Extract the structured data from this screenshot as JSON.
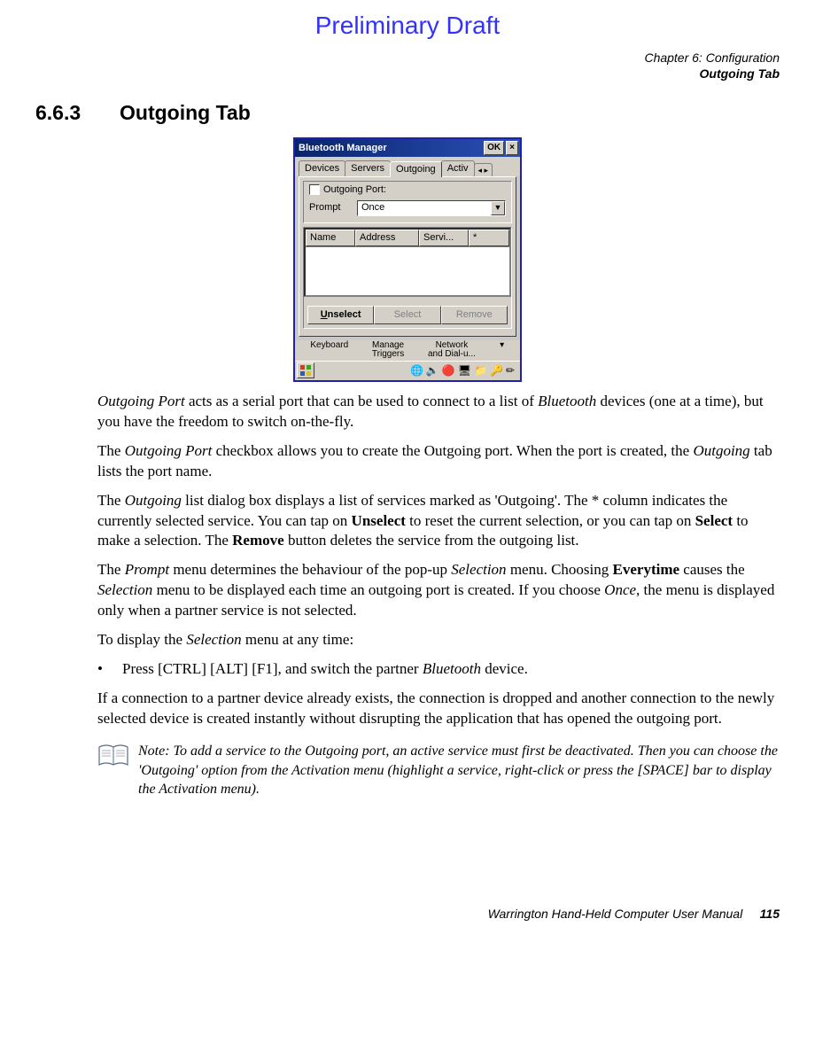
{
  "watermark": "Preliminary Draft",
  "chapter": {
    "line1": "Chapter 6: Configuration",
    "line2": "Outgoing Tab"
  },
  "heading": {
    "number": "6.6.3",
    "title": "Outgoing Tab"
  },
  "screenshot": {
    "window_title": "Bluetooth Manager",
    "ok_button": "OK",
    "close_button": "×",
    "tabs": {
      "devices": "Devices",
      "servers": "Servers",
      "outgoing": "Outgoing",
      "activ": "Activ"
    },
    "tab_scroll": "◂ ▸",
    "group_label": "Outgoing Port:",
    "prompt_label": "Prompt",
    "prompt_value": "Once",
    "list_headers": {
      "name": "Name",
      "address": "Address",
      "service": "Servi...",
      "star": "*"
    },
    "buttons": {
      "unselect_u": "U",
      "unselect_rest": "nselect",
      "select": "Select",
      "remove": "Remove"
    },
    "bg_labels": {
      "keyboard": "Keyboard",
      "manage1": "Manage",
      "manage2": "Triggers",
      "net1": "Network",
      "net2": "and Dial-u..."
    },
    "tray_icons": [
      "🌐",
      "🔈",
      "🔴",
      "🖥",
      "📁",
      "🔑",
      "✏"
    ]
  },
  "paragraphs": {
    "p1a": "Outgoing Port",
    "p1b": " acts as a serial port that can be used to connect to a list of ",
    "p1c": "Bluetooth",
    "p1d": " devices (one at a time), but you have the freedom to switch on-the-fly.",
    "p2a": "The ",
    "p2b": "Outgoing Port",
    "p2c": " checkbox allows you to create the Outgoing port. When the port is created, the ",
    "p2d": "Outgoing",
    "p2e": " tab lists the port name.",
    "p3a": "The ",
    "p3b": "Outgoing",
    "p3c": " list dialog box displays a list of services marked as 'Outgoing'. The * column indicates the currently selected service. You can tap on ",
    "p3d": "Unselect",
    "p3e": " to reset the current selection, or you can tap on ",
    "p3f": "Select",
    "p3g": " to make a selection. The ",
    "p3h": "Remove",
    "p3i": " button deletes the service from the outgoing list.",
    "p4a": "The ",
    "p4b": "Prompt",
    "p4c": " menu determines the behaviour of the pop-up ",
    "p4d": "Selection",
    "p4e": " menu. Choosing ",
    "p4f": "Everytime",
    "p4g": " causes the ",
    "p4h": "Selection",
    "p4i": " menu to be displayed each time an outgoing port is created. If you choose ",
    "p4j": "Once",
    "p4k": ", the menu is displayed only when a partner service is not selected.",
    "p5a": "To display the ",
    "p5b": "Selection",
    "p5c": " menu at any time:",
    "bullet_a": "Press [CTRL] [ALT] [F1], and switch the partner ",
    "bullet_b": "Bluetooth",
    "bullet_c": " device.",
    "p6": "If a connection to a partner device already exists, the connection is dropped and another connection to the newly selected device is created instantly without disrupting the application that has opened the outgoing port."
  },
  "note": {
    "text": "Note: To add a service to the Outgoing port, an active service must first be deactivated. Then you can choose the 'Outgoing' option from the Activation menu (highlight a service, right-click or press the [SPACE] bar to display the Activation menu)."
  },
  "footer": {
    "manual": "Warrington Hand-Held Computer User Manual",
    "page": "115"
  },
  "bullet_dot": "•"
}
